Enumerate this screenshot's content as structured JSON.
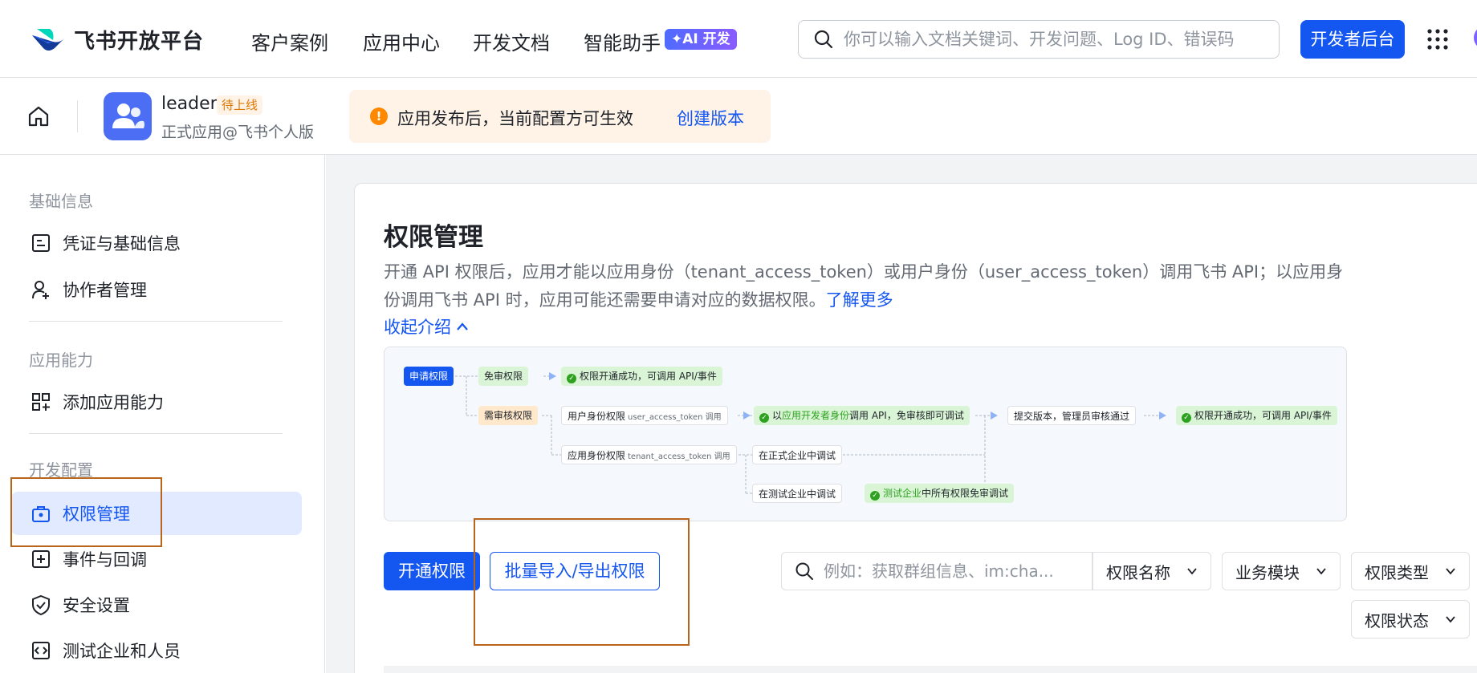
{
  "topnav": {
    "logo_text": "飞书开放平台",
    "links": [
      "客户案例",
      "应用中心",
      "开发文档",
      "智能助手"
    ],
    "ai_badge": "✦AI 开发",
    "search_placeholder": "你可以输入文档关键词、开发问题、Log ID、错误码",
    "dev_console_label": "开发者后台"
  },
  "app_header": {
    "app_name": "leader",
    "status": "待上线",
    "app_subtitle": "正式应用@飞书个人版",
    "notice_text": "应用发布后，当前配置方可生效",
    "notice_link": "创建版本"
  },
  "sidebar": {
    "groups": [
      "基础信息",
      "应用能力",
      "开发配置"
    ],
    "items": [
      {
        "label": "凭证与基础信息",
        "icon": "credential-icon"
      },
      {
        "label": "协作者管理",
        "icon": "add-user-icon"
      },
      {
        "label": "添加应用能力",
        "icon": "apps-add-icon"
      },
      {
        "label": "权限管理",
        "icon": "permission-icon",
        "active": true
      },
      {
        "label": "事件与回调",
        "icon": "event-icon"
      },
      {
        "label": "安全设置",
        "icon": "shield-icon"
      },
      {
        "label": "测试企业和人员",
        "icon": "code-icon"
      }
    ]
  },
  "main": {
    "title": "权限管理",
    "description": "开通 API 权限后，应用才能以应用身份（tenant_access_token）或用户身份（user_access_token）调用飞书 API；以应用身份调用飞书 API 时，应用可能还需要申请对应的数据权限。",
    "learn_more": "了解更多",
    "collapse_label": "收起介绍",
    "flow": {
      "apply": "申请权限",
      "free": "免审权限",
      "success": "权限开通成功，可调用 API/事件",
      "review": "需审核权限",
      "user_identity": "用户身份权限",
      "user_token_note": "user_access_token 调用",
      "dev_identity_pre": "以",
      "dev_identity_green": "应用开发者身份",
      "dev_identity_post": "调用 API，免审核即可调试",
      "submit": "提交版本，管理员审核通过",
      "success2": "权限开通成功，可调用 API/事件",
      "app_identity": "应用身份权限",
      "tenant_token_note": "tenant_access_token 调用",
      "prod_debug": "在正式企业中调试",
      "test_debug": "在测试企业中调试",
      "test_all_green": "测试企业",
      "test_all_post": "中所有权限免审调试"
    },
    "btn_enable": "开通权限",
    "btn_batch": "批量导入/导出权限",
    "filter_placeholder": "例如：获取群组信息、im:cha...",
    "filters": [
      "权限名称",
      "业务模块",
      "权限类型",
      "权限状态"
    ]
  },
  "colors": {
    "accent": "#1456f0",
    "highlight_box": "#b8651b",
    "warning": "#ff8800"
  }
}
